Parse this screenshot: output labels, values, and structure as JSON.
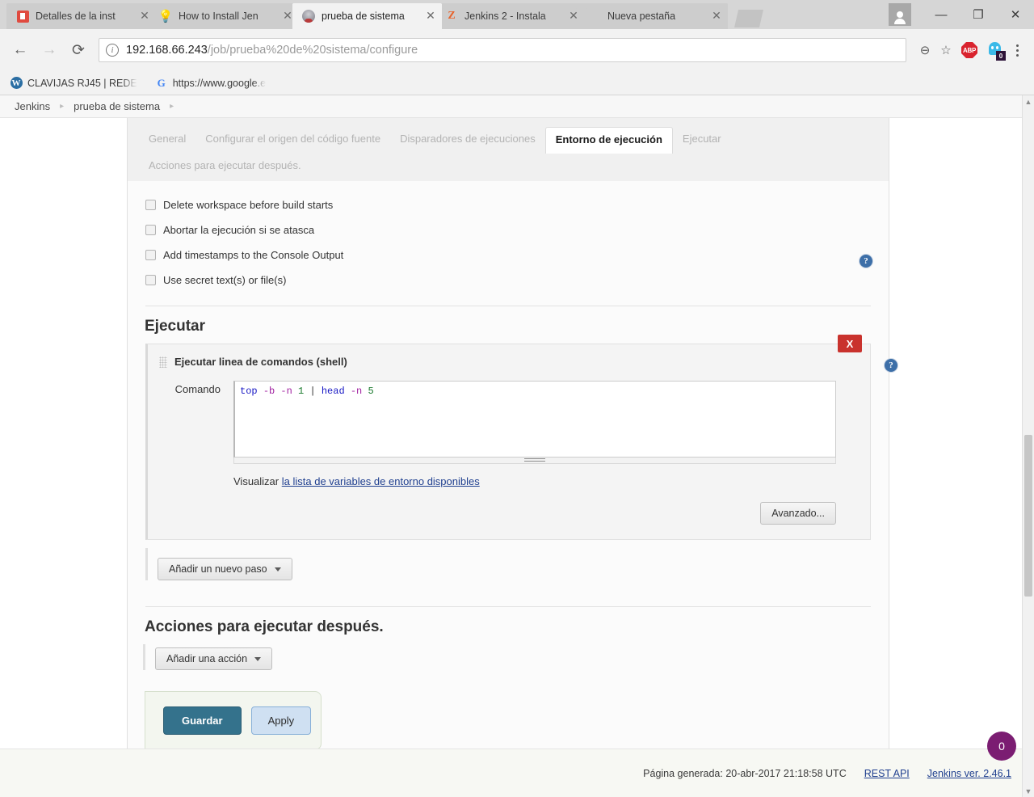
{
  "browser": {
    "tabs": [
      {
        "title": "Detalles de la inst",
        "favicon": "red-book-icon",
        "active": false
      },
      {
        "title": "How to Install Jen",
        "favicon": "lightbulb-icon",
        "active": false
      },
      {
        "title": "prueba de sistema",
        "favicon": "jenkins-icon",
        "active": true
      },
      {
        "title": "Jenkins 2 - Instala",
        "favicon": "zeta-icon",
        "active": false
      },
      {
        "title": "Nueva pestaña",
        "favicon": "blank-icon",
        "active": false
      }
    ],
    "close_glyph": "✕",
    "window_controls": {
      "minimize": "—",
      "restore": "❐",
      "close": "✕"
    },
    "nav": {
      "back": "←",
      "forward": "→",
      "reload": "⟳"
    },
    "omnibox": {
      "info_glyph": "i",
      "url_host": "192.168.66.243",
      "url_path": "/job/prueba%20de%20sistema/configure",
      "zoom_glyph": "⊖",
      "bookmark_glyph": "☆"
    },
    "extensions": [
      {
        "name": "adblock-plus",
        "label": "ABP"
      },
      {
        "name": "ghostery",
        "badge": "0"
      }
    ],
    "bookmarks": [
      {
        "label": "CLAVIJAS RJ45 | REDE",
        "icon": "wordpress-icon",
        "glyph": "W"
      },
      {
        "label": "https://www.google.e",
        "icon": "google-icon",
        "glyph": "G"
      }
    ]
  },
  "jenkins": {
    "breadcrumbs": [
      {
        "label": "Jenkins"
      },
      {
        "label": "prueba de sistema"
      }
    ],
    "breadcrumb_sep": "▸",
    "config_tabs": [
      {
        "label": "General",
        "active": false
      },
      {
        "label": "Configurar el origen del código fuente",
        "active": false
      },
      {
        "label": "Disparadores de ejecuciones",
        "active": false
      },
      {
        "label": "Entorno de ejecución",
        "active": true
      },
      {
        "label": "Ejecutar",
        "active": false
      }
    ],
    "config_tabs_row2": [
      {
        "label": "Acciones para ejecutar después.",
        "active": false
      }
    ],
    "environment": {
      "checkboxes": [
        {
          "label": "Delete workspace before build starts",
          "checked": false
        },
        {
          "label": "Abortar la ejecución si se atasca",
          "checked": false
        },
        {
          "label": "Add timestamps to the Console Output",
          "checked": false
        },
        {
          "label": "Use secret text(s) or file(s)",
          "checked": false
        }
      ],
      "help_glyph": "?"
    },
    "build_section": {
      "title": "Ejecutar",
      "step": {
        "title": "Ejecutar linea de comandos (shell)",
        "remove_label": "X",
        "help_glyph": "?",
        "field_label": "Comando",
        "command_tokens": [
          {
            "text": "top",
            "type": "cmd"
          },
          {
            "text": " ",
            "type": "plain"
          },
          {
            "text": "-b",
            "type": "flag"
          },
          {
            "text": " ",
            "type": "plain"
          },
          {
            "text": "-n",
            "type": "flag"
          },
          {
            "text": " ",
            "type": "plain"
          },
          {
            "text": "1",
            "type": "num"
          },
          {
            "text": " ",
            "type": "plain"
          },
          {
            "text": "|",
            "type": "pipe"
          },
          {
            "text": " ",
            "type": "plain"
          },
          {
            "text": "head",
            "type": "cmd"
          },
          {
            "text": " ",
            "type": "plain"
          },
          {
            "text": "-n",
            "type": "flag"
          },
          {
            "text": " ",
            "type": "plain"
          },
          {
            "text": "5",
            "type": "num"
          }
        ],
        "command_plain": "top -b -n 1 | head -n 5",
        "visualize_prefix": "Visualizar",
        "visualize_link": "la lista de variables de entorno disponibles",
        "advanced_label": "Avanzado..."
      },
      "add_step_label": "Añadir un nuevo paso"
    },
    "post_section": {
      "title": "Acciones para ejecutar después.",
      "add_action_label": "Añadir una acción"
    },
    "actions": {
      "save_label": "Guardar",
      "apply_label": "Apply"
    },
    "footer": {
      "generated": "Página generada: 20-abr-2017 21:18:58 UTC",
      "rest_api": "REST API",
      "version": "Jenkins ver. 2.46.1",
      "notification_count": "0"
    }
  }
}
